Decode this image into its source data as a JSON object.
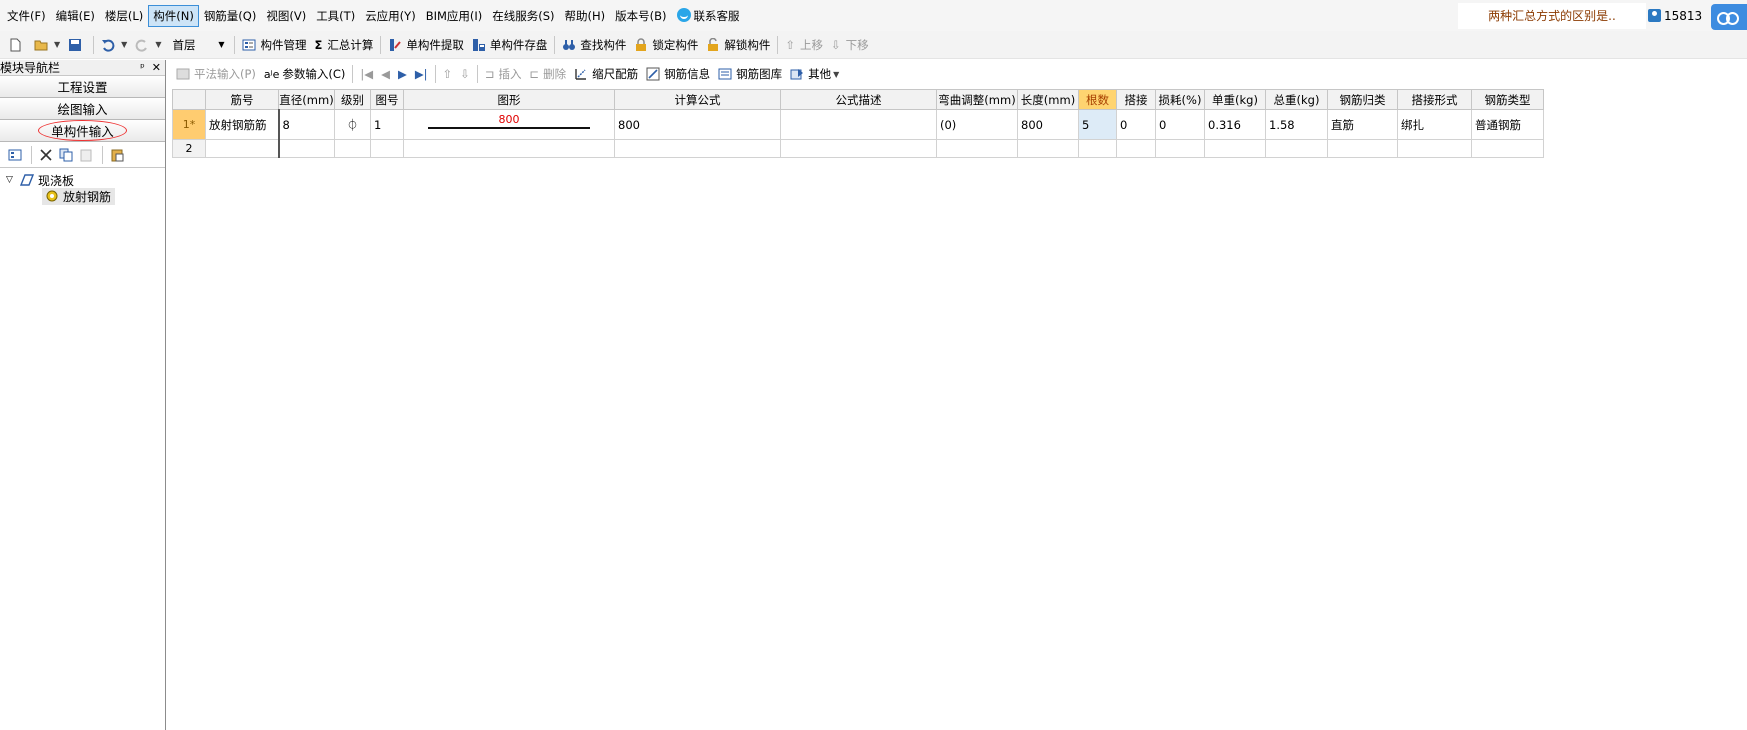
{
  "menu": {
    "items": [
      "文件(F)",
      "编辑(E)",
      "楼层(L)",
      "构件(N)",
      "钢筋量(Q)",
      "视图(V)",
      "工具(T)",
      "云应用(Y)",
      "BIM应用(I)",
      "在线服务(S)",
      "帮助(H)",
      "版本号(B)"
    ],
    "service_label": "联系客服",
    "notice": "两种汇总方式的区别是..",
    "user_id": "15813"
  },
  "toolbar1": {
    "floor": "首层",
    "component_manage": "构件管理",
    "summary_calc": "汇总计算",
    "single_extract": "单构件提取",
    "single_save": "单构件存盘",
    "find_component": "查找构件",
    "lock_component": "锁定构件",
    "unlock_component": "解锁构件",
    "move_up": "上移",
    "move_down": "下移",
    "sum_symbol": "Σ"
  },
  "left_panel": {
    "title": "模块导航栏",
    "pin_glyph": "ᵖ",
    "close_glyph": "✕",
    "nav": [
      "工程设置",
      "绘图输入",
      "单构件输入"
    ],
    "tree_parent": "现浇板",
    "tree_child": "放射钢筋"
  },
  "toolbar2": {
    "flat_input": "平法输入(P)",
    "param_input": "参数输入(C)",
    "param_glyph": "aʲe",
    "insert": "插入",
    "delete": "删除",
    "scale_config": "缩尺配筋",
    "rebar_info": "钢筋信息",
    "rebar_library": "钢筋图库",
    "other": "其他"
  },
  "table": {
    "headers": [
      "筋号",
      "直径(mm)",
      "级别",
      "图号",
      "图形",
      "计算公式",
      "公式描述",
      "弯曲调整(mm)",
      "长度(mm)",
      "根数",
      "搭接",
      "损耗(%)",
      "单重(kg)",
      "总重(kg)",
      "钢筋归类",
      "搭接形式",
      "钢筋类型"
    ],
    "rows": [
      {
        "num": "1*",
        "name": "放射钢筋筋",
        "diameter": "8",
        "grade": "⏀",
        "fig_no": "1",
        "shape_len": "800",
        "formula": "800",
        "formula_desc": "",
        "bend_adjust": "(0)",
        "length": "800",
        "count": "5",
        "lap": "0",
        "loss": "0",
        "unit_weight": "0.316",
        "total_weight": "1.58",
        "category": "直筋",
        "lap_type": "绑扎",
        "rebar_type": "普通钢筋"
      },
      {
        "num": "2"
      }
    ]
  },
  "colors": {
    "active_menu_bg": "#cde4f7",
    "active_menu_border": "#3c8fd8",
    "highlight_header": "#ffd470",
    "shape_length": "#e00000",
    "notice_text": "#8b3a00"
  }
}
